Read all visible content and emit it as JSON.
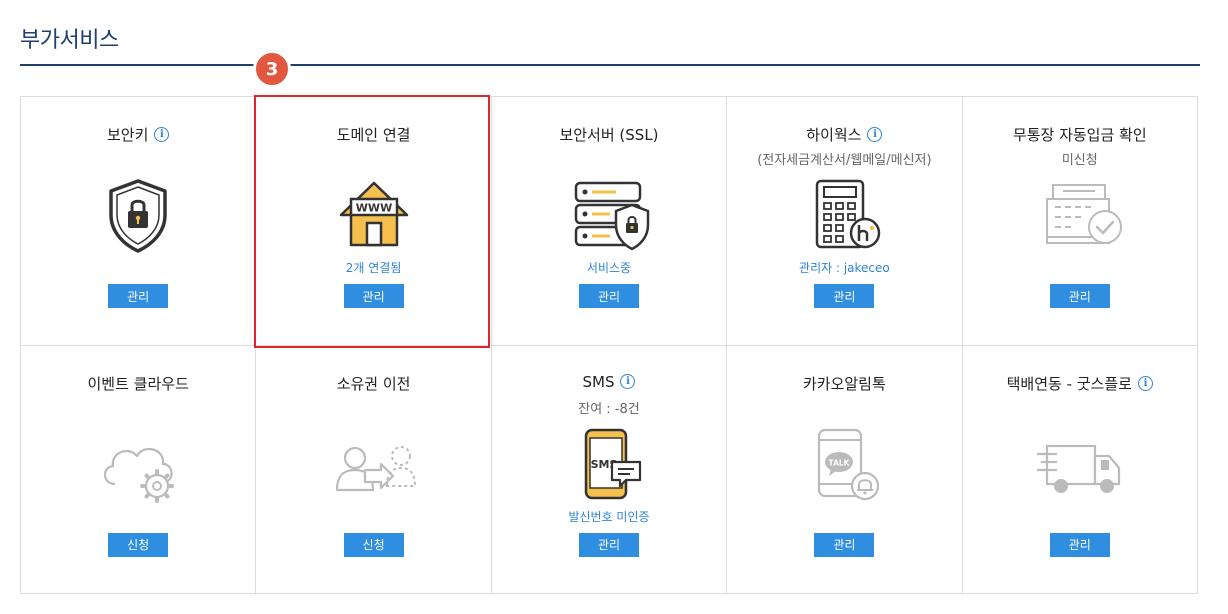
{
  "section_title": "부가서비스",
  "step_badge": "3",
  "button_color": "#2f8ee0",
  "highlight_color": "#e0262a",
  "cards": [
    {
      "title": "보안키",
      "info": true,
      "subtitle": "",
      "status": "",
      "button": "관리",
      "icon": "shield-lock-icon"
    },
    {
      "title": "도메인 연결",
      "info": false,
      "subtitle": "",
      "status": "2개 연결됨",
      "button": "관리",
      "icon": "www-house-icon"
    },
    {
      "title": "보안서버 (SSL)",
      "info": false,
      "subtitle": "",
      "status": "서비스중",
      "button": "관리",
      "icon": "server-shield-icon"
    },
    {
      "title": "하이웍스",
      "info": true,
      "subtitle": "(전자세금계산서/웹메일/메신저)",
      "status": "관리자 : jakeceo",
      "button": "관리",
      "icon": "calculator-icon"
    },
    {
      "title": "무통장 자동입금 확인",
      "info": false,
      "subtitle": "미신청",
      "status": "",
      "button": "관리",
      "icon": "bank-check-icon"
    },
    {
      "title": "이벤트 클라우드",
      "info": false,
      "subtitle": "",
      "status": "",
      "button": "신청",
      "icon": "cloud-gear-icon"
    },
    {
      "title": "소유권 이전",
      "info": false,
      "subtitle": "",
      "status": "",
      "button": "신청",
      "icon": "ownership-transfer-icon"
    },
    {
      "title": "SMS",
      "info": true,
      "subtitle": "잔여 : -8건",
      "status": "발신번호 미인증",
      "button": "관리",
      "icon": "sms-phone-icon"
    },
    {
      "title": "카카오알림톡",
      "info": false,
      "subtitle": "",
      "status": "",
      "button": "관리",
      "icon": "kakao-talk-phone-icon"
    },
    {
      "title": "택배연동 - 굿스플로",
      "info": true,
      "subtitle": "",
      "status": "",
      "button": "관리",
      "icon": "delivery-truck-icon"
    }
  ],
  "icon_labels": {
    "www": "WWW",
    "sms": "SMS",
    "talk": "TALK"
  }
}
